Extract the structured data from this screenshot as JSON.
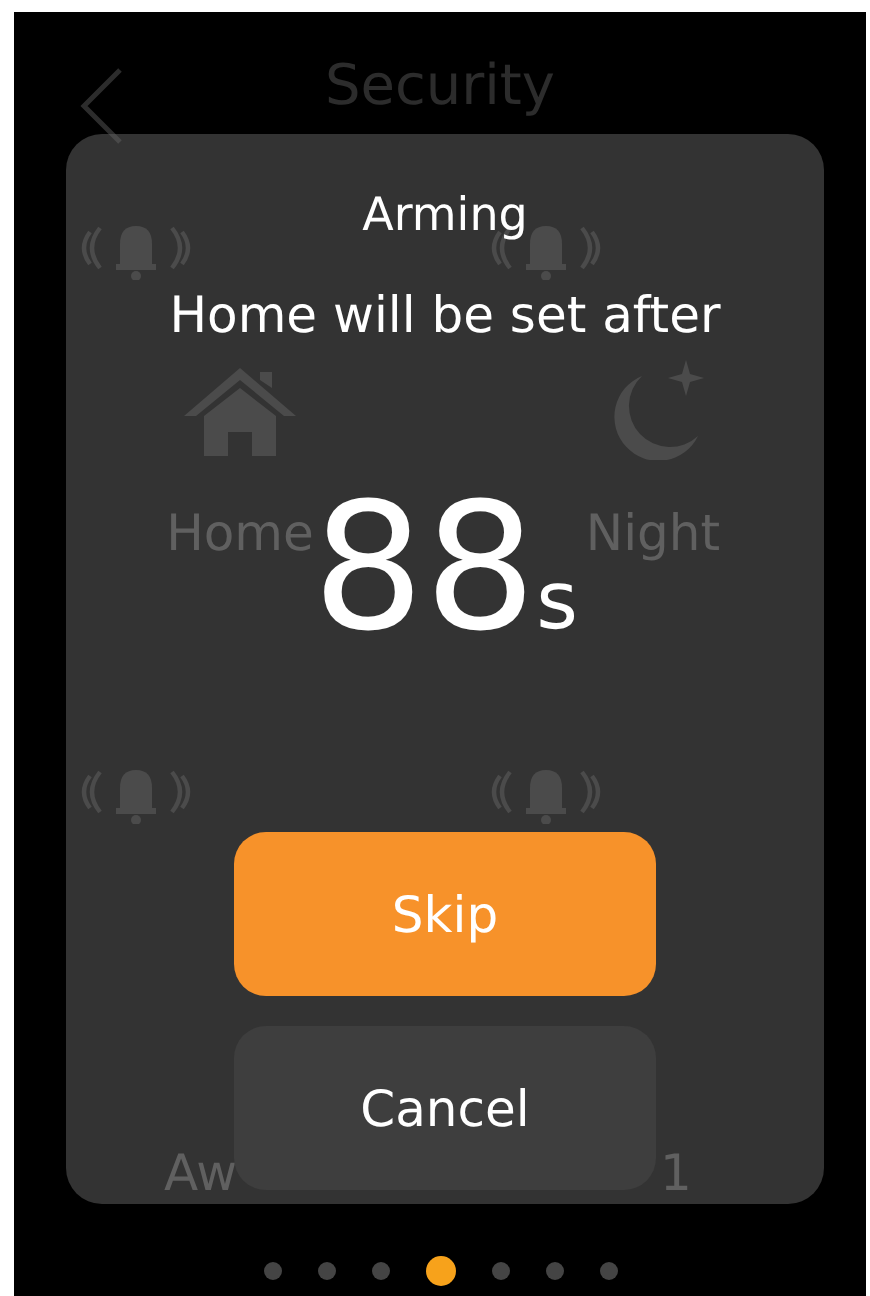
{
  "header": {
    "title": "Security"
  },
  "modes": [
    {
      "label": "Home"
    },
    {
      "label": "Night"
    },
    {
      "label": "Aw"
    },
    {
      "label": "1"
    }
  ],
  "dialog": {
    "title": "Arming",
    "message": "Home will be set after",
    "countdown": "88",
    "unit": "s",
    "buttons": [
      {
        "label": "Skip",
        "kind": "primary"
      },
      {
        "label": "Cancel",
        "kind": "secondary"
      }
    ]
  },
  "pager": [
    {
      "selected": false
    },
    {
      "selected": false
    },
    {
      "selected": false
    },
    {
      "selected": true
    },
    {
      "selected": false
    },
    {
      "selected": false
    },
    {
      "selected": false
    }
  ]
}
